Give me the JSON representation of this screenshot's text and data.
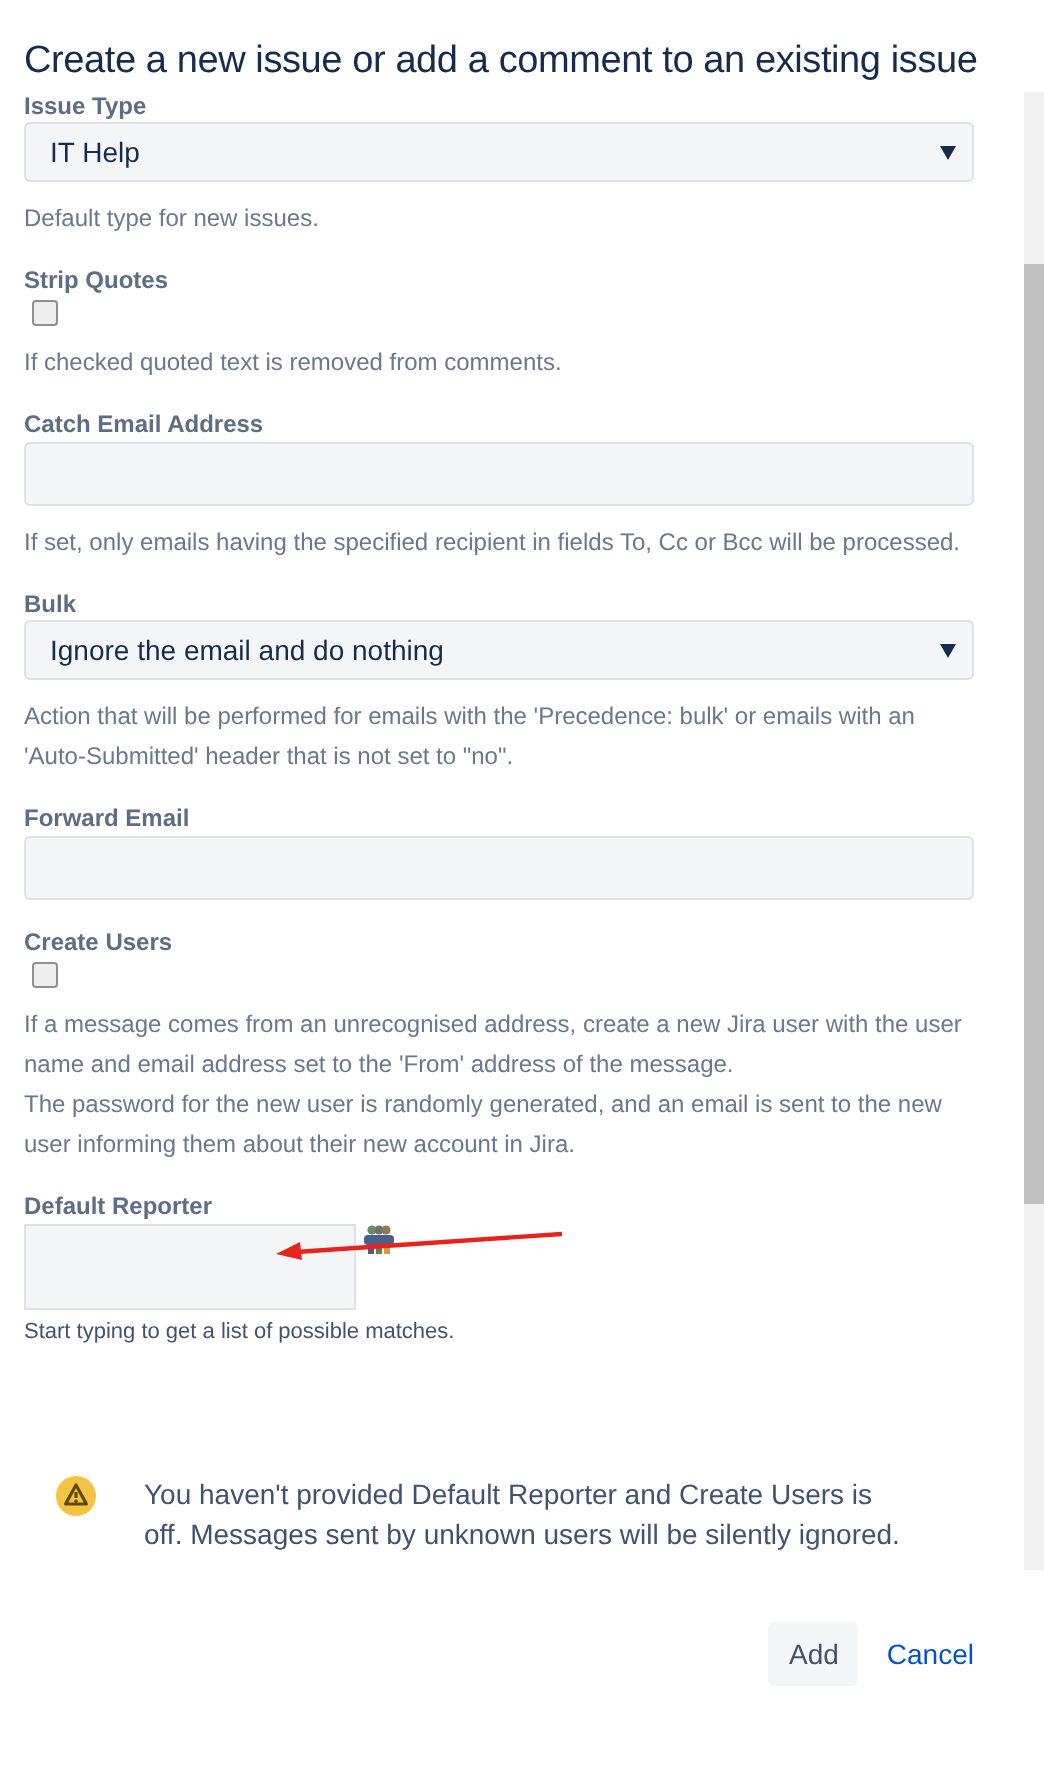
{
  "dialog": {
    "title": "Create a new issue or add a comment to an existing issue"
  },
  "fields": [
    {
      "kind": "select",
      "label": "Issue Type",
      "value": "IT Help",
      "help": "Default type for new issues."
    },
    {
      "kind": "checkbox",
      "label": "Strip Quotes",
      "checked": false,
      "help": "If checked quoted text is removed from comments."
    },
    {
      "kind": "text",
      "label": "Catch Email Address",
      "help": "If set, only emails having the specified recipient in fields To, Cc or Bcc will be processed."
    },
    {
      "kind": "select",
      "label": "Bulk",
      "value": "Ignore the email and do nothing",
      "help": "Action that will be performed for emails with the 'Precedence: bulk' or emails with an 'Auto-Submitted' header that is not set to \"no\"."
    },
    {
      "kind": "text",
      "label": "Forward Email"
    },
    {
      "kind": "checkbox",
      "label": "Create Users",
      "checked": false,
      "help": "If a message comes from an unrecognised address, create a new Jira user with the user name and email address set to the 'From' address of the message.\nThe password for the new user is randomly generated, and an email is sent to the new user informing them about their new account in Jira."
    },
    {
      "kind": "userpicker",
      "label": "Default Reporter",
      "help": "Start typing to get a list of possible matches."
    }
  ],
  "warning": "You haven't provided Default Reporter and Create Users is off. Messages sent by unknown users will be silently ignored.",
  "buttons": [
    {
      "kind": "primary",
      "label": "Add"
    },
    {
      "kind": "link",
      "label": "Cancel"
    }
  ]
}
